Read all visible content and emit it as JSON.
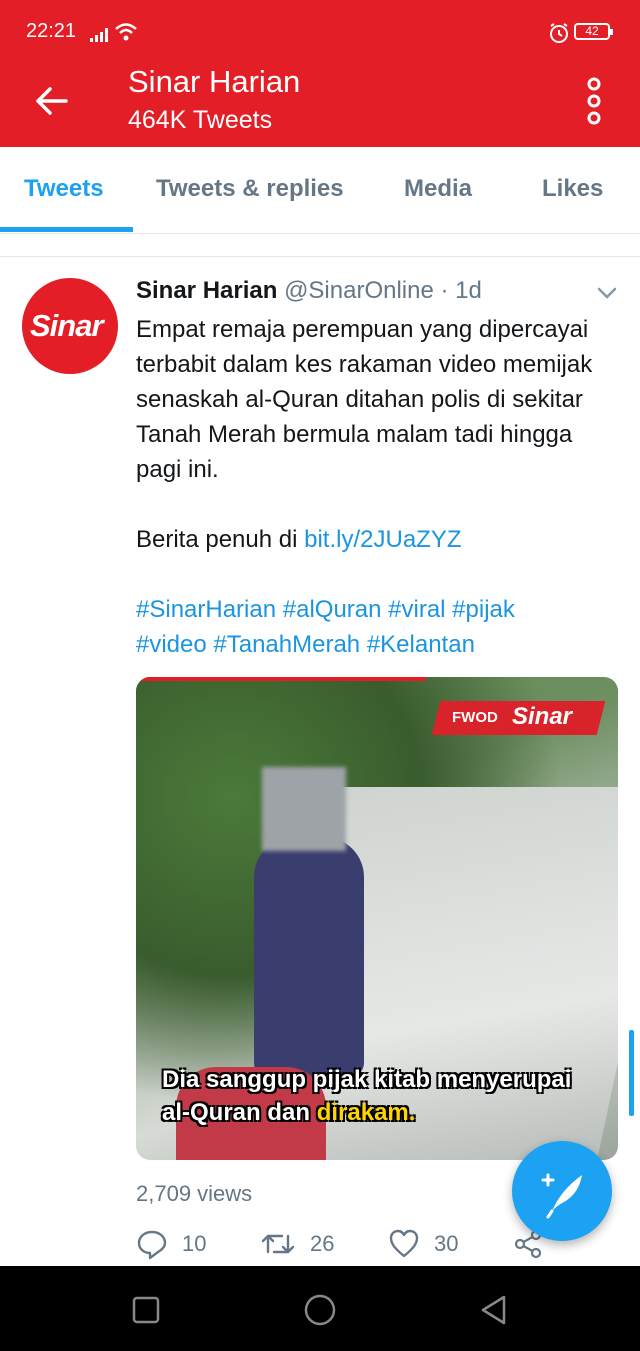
{
  "status_bar": {
    "time": "22:21",
    "battery": "42"
  },
  "header": {
    "title": "Sinar Harian",
    "subtitle": "464K Tweets"
  },
  "tabs": [
    {
      "label": "Tweets",
      "active": true
    },
    {
      "label": "Tweets & replies",
      "active": false
    },
    {
      "label": "Media",
      "active": false
    },
    {
      "label": "Likes",
      "active": false
    }
  ],
  "tweet": {
    "avatar_text": "Sinar",
    "name": "Sinar Harian",
    "handle": "@SinarOnline",
    "time": "· 1d",
    "text": "Empat remaja perempuan yang dipercayai terbabit dalam kes rakaman video memijak senaskah al-Quran ditahan polis di sekitar Tanah Merah bermula malam tadi hingga pagi ini.",
    "link_prefix": "Berita penuh di",
    "link": "bit.ly/2JUaZYZ",
    "hashtags_line1": "#SinarHarian #alQuran #viral #pijak",
    "hashtags_line2": "#video #TanahMerah #Kelantan",
    "media": {
      "badge_left": "FWOD",
      "badge_right": "Sinar",
      "caption_line1": "Dia sanggup pijak kitab menyerupai",
      "caption_line2_part1": "al-Quran dan",
      "caption_line2_highlight": "dirakam."
    },
    "views": "2,709 views",
    "actions": {
      "replies": "10",
      "retweets": "26",
      "likes": "30"
    }
  },
  "colors": {
    "brand_red": "#e41e26",
    "twitter_blue": "#1da1f2",
    "muted": "#657786"
  }
}
